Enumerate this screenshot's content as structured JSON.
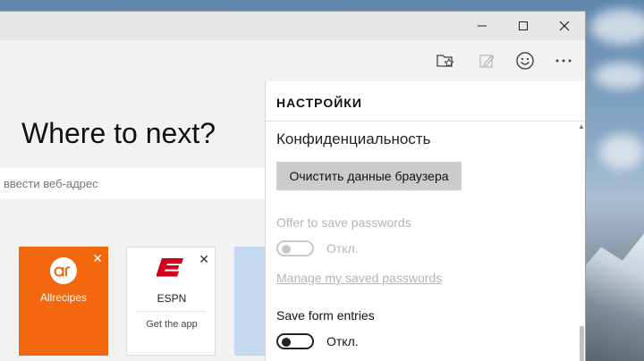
{
  "window": {
    "controls": {
      "minimize": "minimize-icon",
      "maximize": "maximize-icon",
      "close": "close-icon"
    }
  },
  "toolbar": {
    "icons": [
      "favorites-reading-list-icon",
      "web-note-icon",
      "feedback-smiley-icon",
      "more-icon"
    ]
  },
  "newtab": {
    "headline": "Where to next?",
    "address_placeholder": "ввести веб-адрес",
    "tiles": [
      {
        "label": "Allrecipes",
        "color": "#f3680f"
      },
      {
        "label": "ESPN",
        "sublabel": "Get the app",
        "logo_color": "#d0021b"
      }
    ]
  },
  "settings": {
    "title": "НАСТРОЙКИ",
    "section": "Конфиденциальность",
    "clear_button": "Очистить данные браузера",
    "offer_passwords": {
      "label": "Offer to save passwords",
      "state": "Откл."
    },
    "manage_passwords_link": "Manage my saved passwords",
    "save_form_entries": {
      "label": "Save form entries",
      "state": "Откл."
    }
  }
}
